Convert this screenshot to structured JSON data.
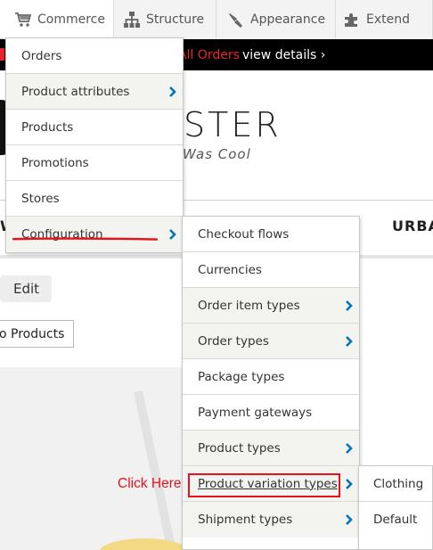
{
  "toolbar": {
    "items": [
      {
        "label": "Commerce",
        "icon": "cart-icon"
      },
      {
        "label": "Structure",
        "icon": "sitemap-icon"
      },
      {
        "label": "Appearance",
        "icon": "paint-brush-icon"
      },
      {
        "label": "Extend",
        "icon": "puzzle-icon"
      }
    ]
  },
  "promo": {
    "highlight": "All Orders",
    "link": "view details"
  },
  "logo": {
    "text": "STER",
    "tagline": "Was Cool"
  },
  "nav": {
    "right_item": "URBA"
  },
  "page": {
    "edit_tab": "Edit",
    "back_button": "o Products"
  },
  "commerce_menu": {
    "items": [
      {
        "label": "Orders"
      },
      {
        "label": "Product attributes"
      },
      {
        "label": "Products"
      },
      {
        "label": "Promotions"
      },
      {
        "label": "Stores"
      },
      {
        "label": "Configuration"
      }
    ]
  },
  "configuration_menu": {
    "items": [
      {
        "label": "Checkout flows"
      },
      {
        "label": "Currencies"
      },
      {
        "label": "Order item types"
      },
      {
        "label": "Order types"
      },
      {
        "label": "Package types"
      },
      {
        "label": "Payment gateways"
      },
      {
        "label": "Product types"
      },
      {
        "label": "Product variation types"
      },
      {
        "label": "Shipment types"
      }
    ]
  },
  "variation_menu": {
    "items": [
      {
        "label": "Clothing"
      },
      {
        "label": "Default"
      }
    ]
  },
  "annotation": {
    "click_here": "Click Here"
  },
  "colors": {
    "accent_blue": "#0074bd",
    "annotation_red": "#e8101a",
    "promo_red": "#e8242a"
  }
}
